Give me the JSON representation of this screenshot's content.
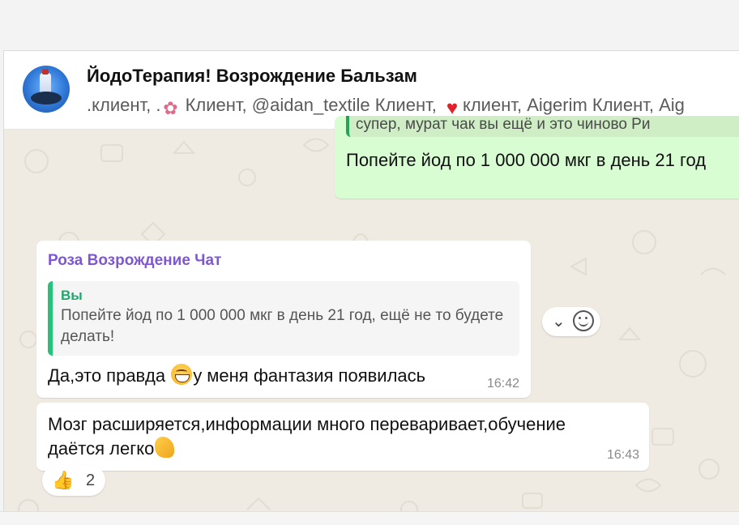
{
  "colors": {
    "outgoing_bubble": "#d9fdd3",
    "incoming_bubble": "#ffffff",
    "sender_name": "#7d57d4",
    "quote_bar": "#25c27b",
    "chat_background": "#efeae2"
  },
  "header": {
    "title": "ЙодоТерапия! Возрождение Бальзам",
    "members_part1": ".клиент, .",
    "members_part2": " Клиент, @aidan_textile Клиент, ",
    "members_part3": "клиент, Aigerim Клиент, Aig"
  },
  "messages": {
    "outgoing_top": {
      "quote_fragment": "супер, мурат чак вы ещё и это чиново Ри",
      "text": "Попейте йод по 1 000 000 мкг в день 21 год"
    },
    "incoming_reply": {
      "sender": "Роза Возрождение Чат",
      "quote_name": "Вы",
      "quote_text": "Попейте йод по 1 000 000 мкг в день 21 год, ещё не то будете делать!",
      "text_before_emoji": "Да,это правда ",
      "text_after_emoji": "у меня фантазия появилась",
      "time": "16:42"
    },
    "incoming_second": {
      "text_line1": "Мозг расширяется,информации много переваривает,обучение",
      "text_line2": "даётся легко",
      "time": "16:43",
      "reaction_icon": "thumbs-up-icon",
      "reaction_count": "2"
    }
  },
  "icons": {
    "react_menu": "chevron-down-icon",
    "emoji_picker": "smile-icon"
  }
}
